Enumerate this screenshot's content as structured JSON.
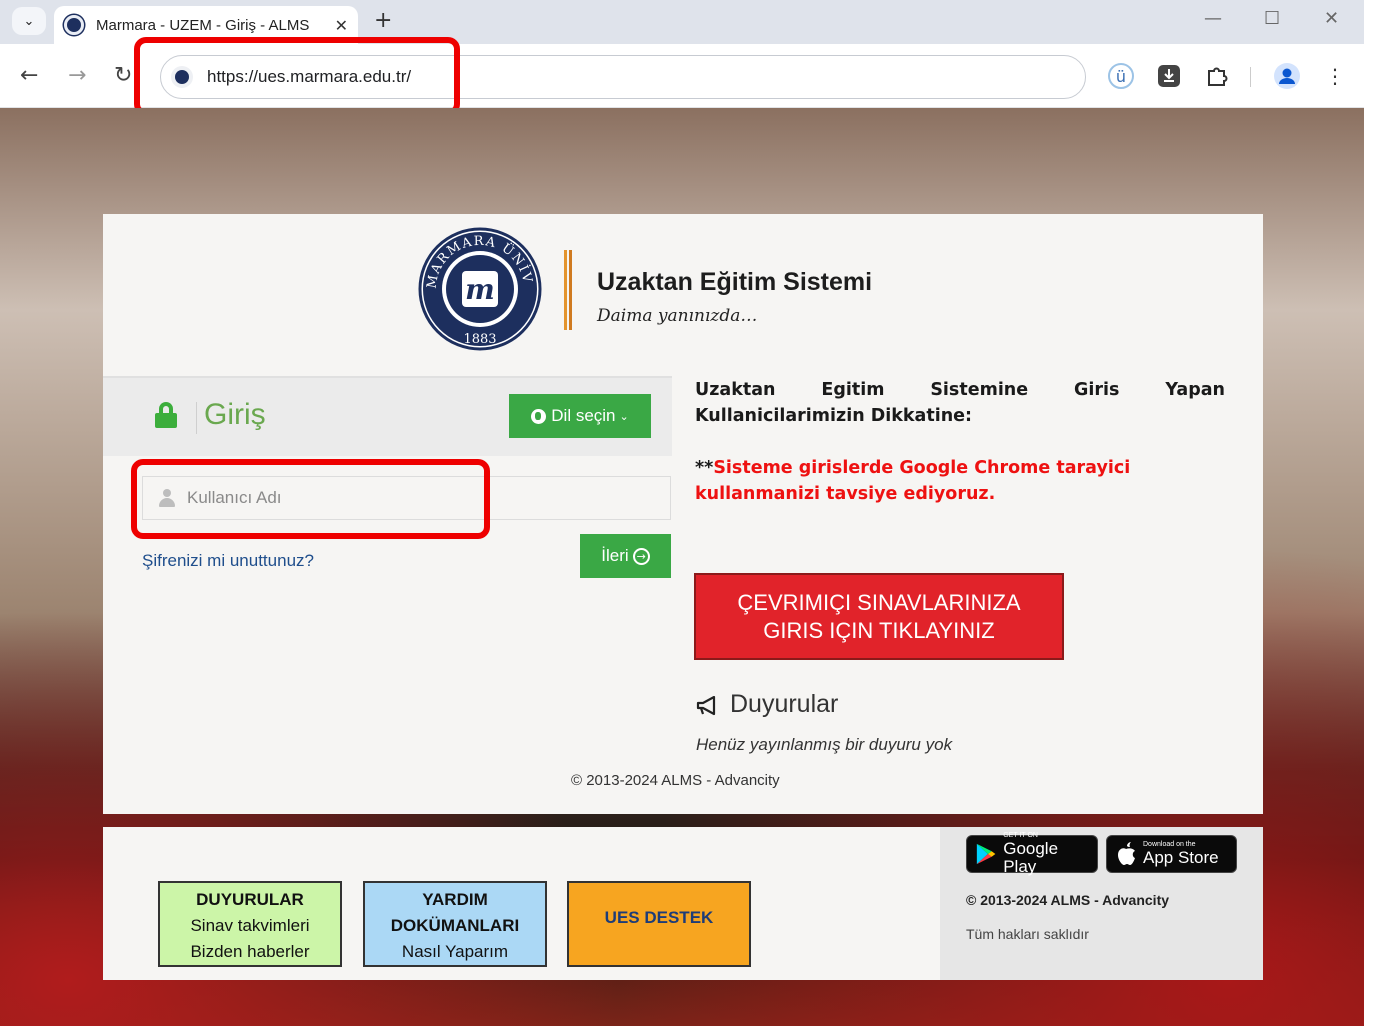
{
  "browser": {
    "tab_title": "Marmara - UZEM - Giriş - ALMS",
    "url": "https://ues.marmara.edu.tr/"
  },
  "logo": {
    "ring_text": "MARMARA ÜNİVERSİTESİ",
    "year": "1883"
  },
  "header": {
    "title": "Uzaktan Eğitim Sistemi",
    "slogan": "Daima yanınızda…"
  },
  "login": {
    "title": "Giriş",
    "language_button": "Dil seçin",
    "username_placeholder": "Kullanıcı Adı",
    "forgot_password": "Şifrenizi mi unuttunuz?",
    "next_button": "İleri"
  },
  "notice": {
    "title": "Uzaktan Egitim Sistemine Giris Yapan Kullanicilarimizin Dikkatine:",
    "stars": "**",
    "warning": "Sisteme girislerde Google Chrome tarayici kullanmanizi tavsiye ediyoruz."
  },
  "exam_button": {
    "line1": "ÇEVRIMIÇI SINAVLARINIZA",
    "line2": "GIRIS IÇIN TIKLAYINIZ"
  },
  "announcements": {
    "title": "Duyurular",
    "empty_text": "Henüz yayınlanmış bir duyuru yok"
  },
  "copyright_mid": "© 2013-2024 ALMS - Advancity",
  "footer": {
    "boxes": [
      {
        "title": "DUYURULAR",
        "line1": "Sinav takvimleri",
        "line2": "Bizden haberler",
        "color": "#ccf5a8"
      },
      {
        "title": "YARDIM",
        "line1": "DOKÜMANLARI",
        "line2": "Nasıl Yaparım",
        "color": "#abd8f5"
      },
      {
        "title": "UES DESTEK",
        "line1": "",
        "line2": "",
        "color": "#f7a520"
      }
    ],
    "google_play": {
      "small": "GET IT ON",
      "big": "Google Play"
    },
    "app_store": {
      "small": "Download on the",
      "big": "App Store"
    },
    "copyright": "© 2013-2024 ALMS - Advancity",
    "rights": "Tüm hakları saklıdır"
  },
  "colors": {
    "highlight": "#ee0000",
    "green": "#3aa845",
    "exam_red": "#e1232a",
    "navy": "#1d2f5e"
  }
}
